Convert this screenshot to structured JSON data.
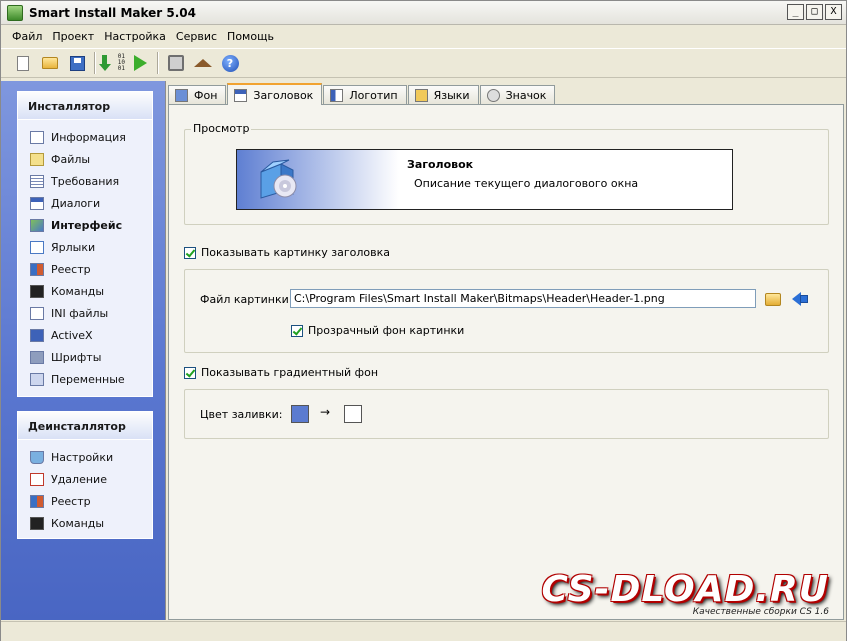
{
  "window": {
    "title": "Smart Install Maker 5.04",
    "buttons": [
      "_",
      "□",
      "X"
    ]
  },
  "menu": [
    "Файл",
    "Проект",
    "Настройка",
    "Сервис",
    "Помощь"
  ],
  "toolbar": {
    "buttons": [
      "new-file-icon",
      "open-folder-icon",
      "save-icon",
      "build-icon",
      "run-icon",
      "tools-icon",
      "home-icon",
      "help-icon"
    ],
    "bits_text": "01\n10\n01",
    "help_glyph": "?"
  },
  "sidebar": {
    "installer": {
      "title": "Инсталлятор",
      "items": [
        {
          "label": "Информация",
          "icon": "info-icon"
        },
        {
          "label": "Файлы",
          "icon": "files-icon"
        },
        {
          "label": "Требования",
          "icon": "requirements-icon"
        },
        {
          "label": "Диалоги",
          "icon": "dialogs-icon"
        },
        {
          "label": "Интерфейс",
          "icon": "interface-icon",
          "active": true
        },
        {
          "label": "Ярлыки",
          "icon": "shortcuts-icon"
        },
        {
          "label": "Реестр",
          "icon": "registry-icon"
        },
        {
          "label": "Команды",
          "icon": "commands-icon"
        },
        {
          "label": "INI файлы",
          "icon": "ini-files-icon"
        },
        {
          "label": "ActiveX",
          "icon": "activex-icon"
        },
        {
          "label": "Шрифты",
          "icon": "fonts-icon"
        },
        {
          "label": "Переменные",
          "icon": "variables-icon"
        }
      ]
    },
    "uninstaller": {
      "title": "Деинсталлятор",
      "items": [
        {
          "label": "Настройки",
          "icon": "settings-icon"
        },
        {
          "label": "Удаление",
          "icon": "delete-icon"
        },
        {
          "label": "Реестр",
          "icon": "registry-icon"
        },
        {
          "label": "Команды",
          "icon": "commands-icon"
        }
      ]
    }
  },
  "tabs": [
    {
      "label": "Фон",
      "icon": "background-icon"
    },
    {
      "label": "Заголовок",
      "icon": "header-icon",
      "active": true
    },
    {
      "label": "Логотип",
      "icon": "logo-icon"
    },
    {
      "label": "Языки",
      "icon": "languages-icon"
    },
    {
      "label": "Значок",
      "icon": "badge-icon"
    }
  ],
  "header_tab": {
    "preview_legend": "Просмотр",
    "preview_title": "Заголовок",
    "preview_desc": "Описание текущего диалогового окна",
    "show_header_image_label": "Показывать картинку заголовка",
    "show_header_image_checked": true,
    "image_file_label": "Файл картинки:",
    "image_file_value": "C:\\Program Files\\Smart Install Maker\\Bitmaps\\Header\\Header-1.png",
    "transparent_bg_label": "Прозрачный фон картинки",
    "transparent_bg_checked": true,
    "show_gradient_label": "Показывать градиентный фон",
    "show_gradient_checked": true,
    "fill_color_label": "Цвет заливки:",
    "fill_color_from": "#5b7bd0",
    "fill_color_to": "#ffffff",
    "arrow": "→"
  },
  "watermark": {
    "brand": "CS-DLOAD.RU",
    "tagline": "Качественные сборки CS 1.6"
  },
  "colors": {
    "sidebar_top": "#7f97de",
    "sidebar_bottom": "#4966c3",
    "active_tab_accent": "#f1a22f"
  }
}
